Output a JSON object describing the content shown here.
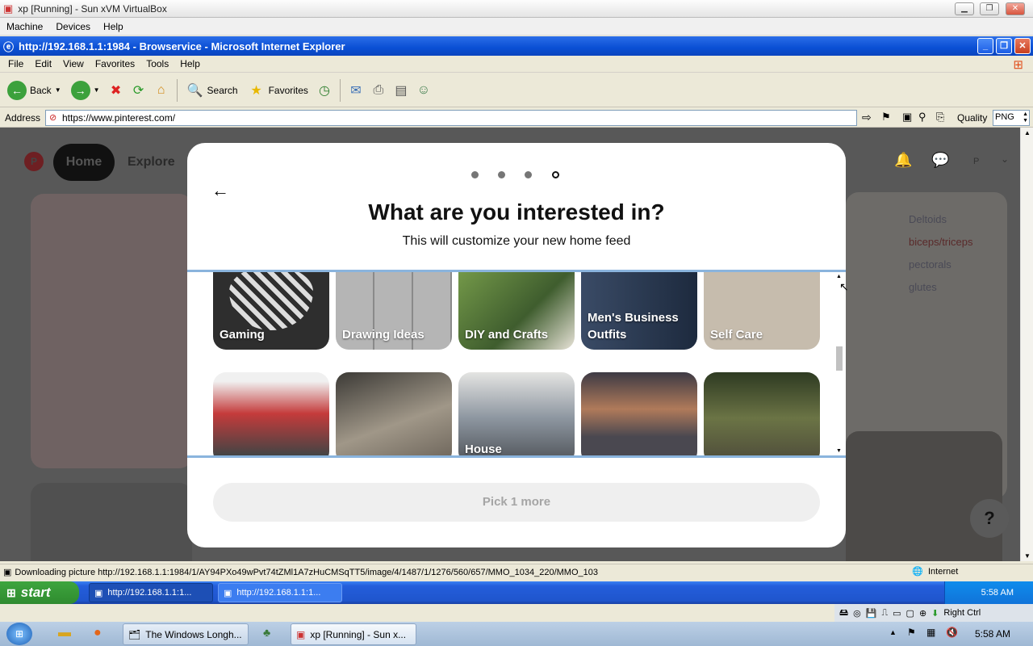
{
  "vbox": {
    "title": "xp [Running] - Sun xVM VirtualBox",
    "menu": [
      "Machine",
      "Devices",
      "Help"
    ]
  },
  "ie": {
    "title": "http://192.168.1.1:1984 - Browservice - Microsoft Internet Explorer",
    "menu": [
      "File",
      "Edit",
      "View",
      "Favorites",
      "Tools",
      "Help"
    ],
    "toolbar": {
      "back": "Back",
      "search": "Search",
      "favorites": "Favorites"
    },
    "address_label": "Address",
    "url": "https://www.pinterest.com/",
    "quality_label": "Quality",
    "quality_value": "PNG"
  },
  "pinterest": {
    "nav": {
      "home": "Home",
      "explore": "Explore",
      "avatar": "P"
    },
    "help": "?",
    "bg_notes": [
      "Deltoids",
      "biceps/triceps",
      "pectorals",
      "glutes"
    ]
  },
  "modal": {
    "title": "What are you interested in?",
    "subtitle": "This will customize your new home feed",
    "steps": 4,
    "active_step": 4,
    "topics_row1": [
      {
        "label": "Gaming",
        "color": "#2e2e2e"
      },
      {
        "label": "Drawing Ideas",
        "color": "#9a9a9a"
      },
      {
        "label": "DIY and Crafts",
        "color": "#6e8a4a"
      },
      {
        "label": "Men's Business Outfits",
        "color": "#2d3b55"
      },
      {
        "label": "Self Care",
        "color": "#b9ad9c"
      }
    ],
    "topics_row2": [
      {
        "label": "",
        "color": "#c43b3b"
      },
      {
        "label": "",
        "color": "#7a6f5f"
      },
      {
        "label": "House",
        "color": "#9aa4ad"
      },
      {
        "label": "",
        "color": "#5c5860"
      },
      {
        "label": "",
        "color": "#5f6a3e"
      }
    ],
    "button": "Pick 1 more"
  },
  "status": {
    "text": "Downloading picture http://192.168.1.1:1984/1/AY94PXo49wPvt74tZMl1A7zHuCMSqTT5/image/4/1487/1/1276/560/657/MMO_1034_220/MMO_103",
    "zone": "Internet"
  },
  "xp_taskbar": {
    "start": "start",
    "buttons": [
      "http://192.168.1.1:1...",
      "http://192.168.1.1:1..."
    ],
    "time": "5:58 AM"
  },
  "host_tray": {
    "key": "Right Ctrl"
  },
  "win_taskbar": {
    "buttons": [
      "The Windows Longh...",
      "xp [Running] - Sun x..."
    ],
    "time": "5:58 AM"
  }
}
